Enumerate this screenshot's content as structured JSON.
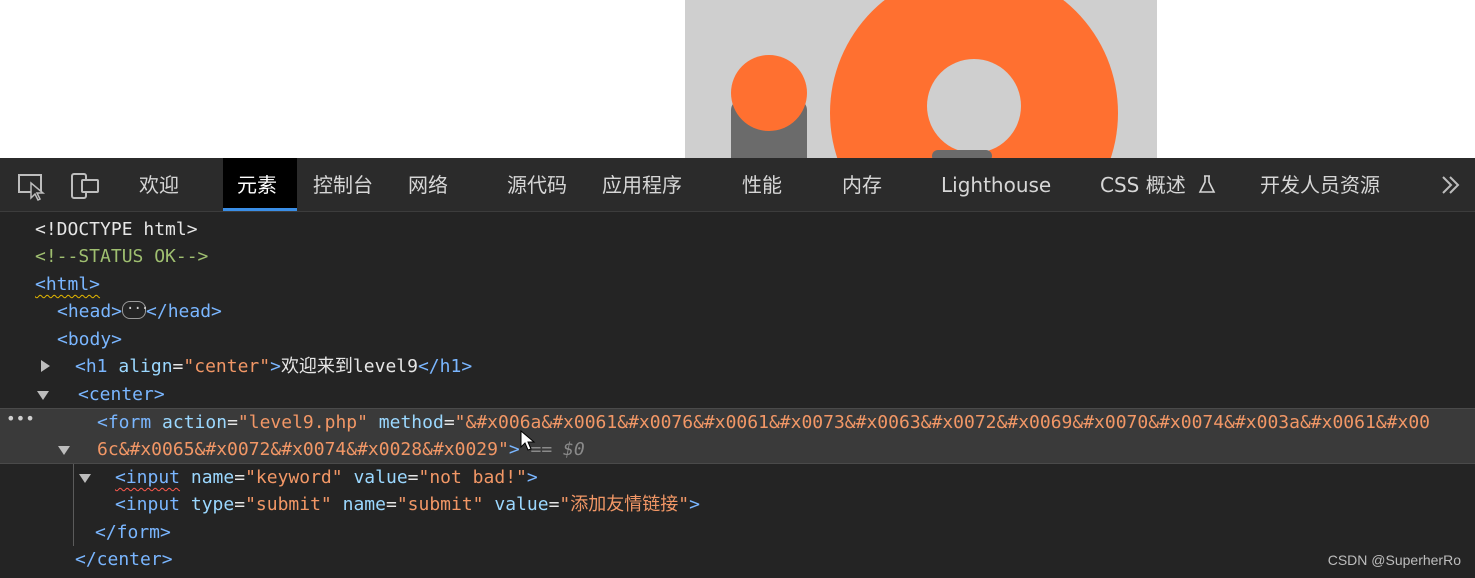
{
  "devtools": {
    "tabs": [
      {
        "label": "欢迎"
      },
      {
        "label": "元素",
        "active": true
      },
      {
        "label": "控制台"
      },
      {
        "label": "网络"
      },
      {
        "label": "源代码"
      },
      {
        "label": "应用程序"
      },
      {
        "label": "性能"
      },
      {
        "label": "内存"
      },
      {
        "label": "Lighthouse"
      },
      {
        "label": "CSS 概述"
      },
      {
        "label": "开发人员资源"
      }
    ],
    "colors": {
      "accent": "#3a8ee6",
      "tag": "#7ab6ff",
      "attr_value": "#f29766",
      "comment": "#9fbf70",
      "bg": "#242424"
    },
    "icons": {
      "inspect": "select-element-icon",
      "device": "device-emulation-icon",
      "experimental": "flask-icon",
      "more": "chevron-double-right-icon"
    }
  },
  "dom": {
    "doctype": "<!DOCTYPE html>",
    "comment": "<!--STATUS OK-->",
    "html_open": "<html>",
    "head_open": "<head>",
    "head_close": "</head>",
    "body_open": "<body>",
    "h1": {
      "open_tag": "<h1",
      "attr": "align",
      "eq": "=",
      "value": "\"center\"",
      "close_gt": ">",
      "text": "欢迎来到level9",
      "close_tag": "</h1>"
    },
    "center_open": "<center>",
    "form": {
      "open_tag": "<form",
      "attr1": "action",
      "eq1": "=",
      "value1": "\"level9.php\"",
      "attr2": "method",
      "eq2": "=",
      "value2_part1": "\"&#x006a&#x0061&#x0076&#x0061&#x0073&#x0063&#x0072&#x0069&#x0070&#x0074&#x003a&#x0061&#x00",
      "value2_part2": "6c&#x0065&#x0072&#x0074&#x0028&#x0029\"",
      "close_gt": ">",
      "console_ref": "== $0"
    },
    "input1": {
      "open_tag": "<input",
      "attr1": "name",
      "eq1": "=",
      "value1": "\"keyword\"",
      "attr2": "value",
      "eq2": "=",
      "value2": "\"not bad!\"",
      "close_gt": ">"
    },
    "input2": {
      "open_tag": "<input",
      "attr1": "type",
      "eq1": "=",
      "value1": "\"submit\"",
      "attr2": "name",
      "eq2": "=",
      "value2": "\"submit\"",
      "attr3": "value",
      "eq3": "=",
      "value3": "\"添加友情链接\"",
      "close_gt": ">"
    },
    "form_close": "</form>",
    "center_close": "</center>",
    "gutter": "•••"
  },
  "watermark": "CSDN @SuperherRo"
}
